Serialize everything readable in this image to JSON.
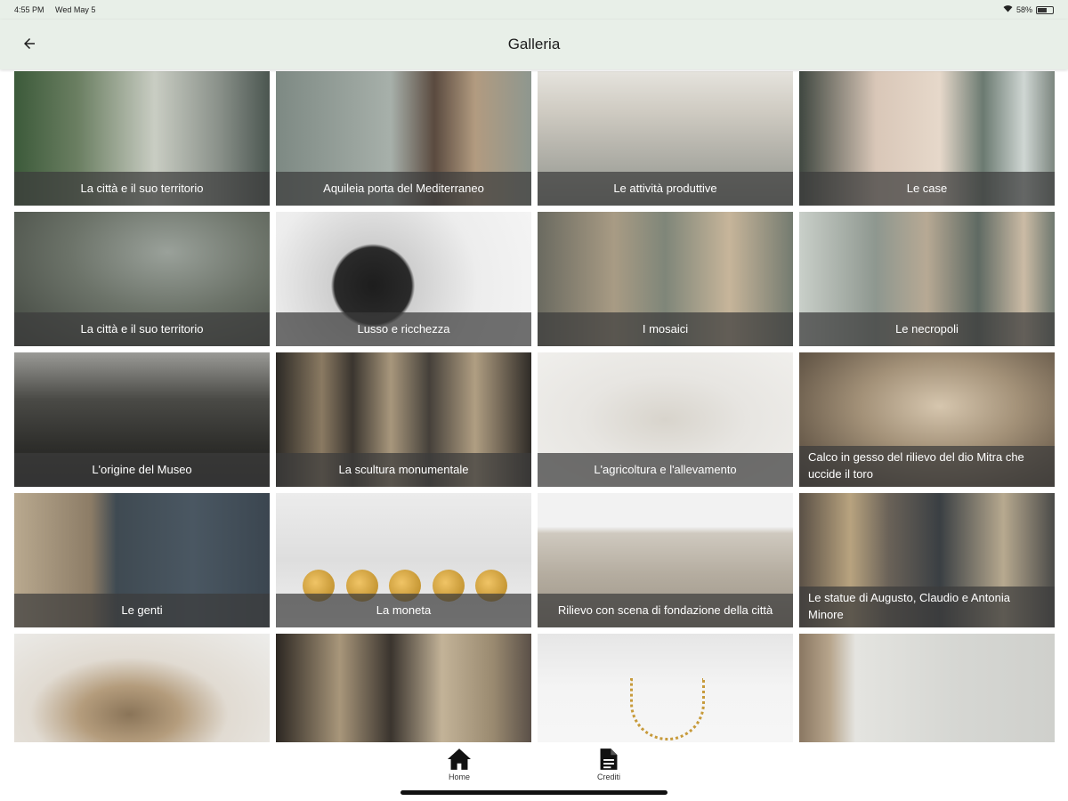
{
  "status": {
    "time": "4:55 PM",
    "date": "Wed May 5",
    "battery": "58%"
  },
  "appbar": {
    "title": "Galleria"
  },
  "gallery": [
    {
      "label": "La città e il suo territorio"
    },
    {
      "label": "Aquileia porta del Mediterraneo"
    },
    {
      "label": "Le attività produttive"
    },
    {
      "label": "Le case"
    },
    {
      "label": "La città e il suo territorio"
    },
    {
      "label": "Lusso e ricchezza"
    },
    {
      "label": "I mosaici"
    },
    {
      "label": "Le necropoli"
    },
    {
      "label": "L'origine del Museo"
    },
    {
      "label": "La scultura monumentale"
    },
    {
      "label": "L'agricoltura e l'allevamento"
    },
    {
      "label": "Calco in gesso del rilievo del dio Mitra che uccide il toro"
    },
    {
      "label": "Le genti"
    },
    {
      "label": "La moneta"
    },
    {
      "label": "Rilievo con scena di fondazione della città"
    },
    {
      "label": "Le statue di Augusto, Claudio e Antonia Minore"
    },
    {
      "label": ""
    },
    {
      "label": ""
    },
    {
      "label": ""
    },
    {
      "label": ""
    }
  ],
  "nav": {
    "home": "Home",
    "credits": "Crediti"
  }
}
